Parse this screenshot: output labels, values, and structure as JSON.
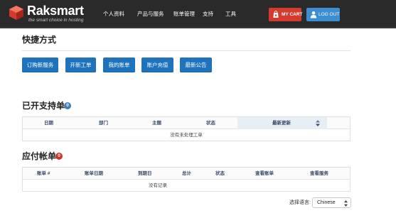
{
  "brand": {
    "name": "Raksmart",
    "tagline": "the smart choice in hosting",
    "accent": "#d63a2f"
  },
  "nav": {
    "items": [
      {
        "label": "个人资料"
      },
      {
        "label": "产品与服务"
      },
      {
        "label": "账单管理"
      },
      {
        "label": "支持"
      },
      {
        "label": "工具"
      }
    ],
    "cart_label": "MY CART",
    "logout_label": "LOG OUT"
  },
  "shortcuts": {
    "title": "快捷方式",
    "buttons": [
      {
        "label": "订购新服务"
      },
      {
        "label": "开新工单"
      },
      {
        "label": "我的账单"
      },
      {
        "label": "账户充值"
      },
      {
        "label": "最新公告"
      }
    ]
  },
  "tickets": {
    "title": "已开支持单",
    "count": "0",
    "columns": [
      "日期",
      "部门",
      "主题",
      "状态",
      "最新更新"
    ],
    "empty_text": "没有未处理工单"
  },
  "invoices": {
    "title": "应付帐单",
    "count": "0",
    "columns": [
      "账单 #",
      "账单日期",
      "到期日",
      "总计",
      "状态",
      "查看账单",
      "查看服务"
    ],
    "empty_text": "没有记录"
  },
  "footer": {
    "language_label": "选择语言:",
    "language_value": "Chinese"
  }
}
